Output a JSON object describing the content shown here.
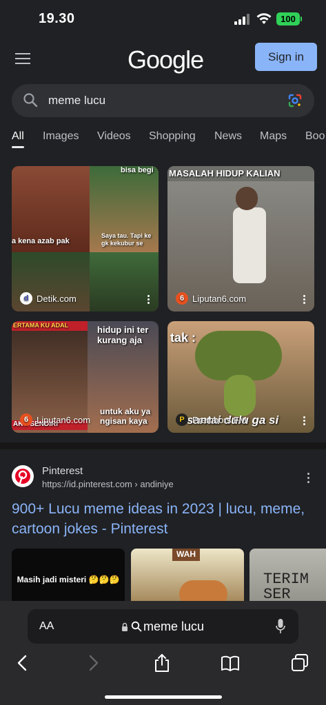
{
  "status": {
    "time": "19.30",
    "battery": "100"
  },
  "header": {
    "logo": "Google",
    "signin_label": "Sign in"
  },
  "search": {
    "query": "meme lucu"
  },
  "tabs": [
    "All",
    "Images",
    "Videos",
    "Shopping",
    "News",
    "Maps",
    "Boo"
  ],
  "images": [
    {
      "source": "Detik.com",
      "favicon": "d",
      "caption_top": "bisa begi",
      "caption_mid": "a kena azab pak",
      "caption_right": "Saya tau. Tapi ke gk kekubur se"
    },
    {
      "source": "Liputan6.com",
      "favicon": "6",
      "caption_top": "MASALAH HIDUP KALIAN"
    },
    {
      "source": "Liputan6.com",
      "favicon": "6",
      "caption_top": "ERTAMA KU ADAL",
      "caption_right_top": "hidup ini ter kurang aja",
      "caption_bottom_left": "AKU SENDIRI",
      "caption_bottom_right": "untuk aku ya ngisan kaya"
    },
    {
      "source": "Prambors FM",
      "favicon": "P",
      "caption_top": "tak :",
      "caption_bottom": "santai dulu ga si"
    }
  ],
  "result": {
    "site": "Pinterest",
    "url": "https://id.pinterest.com › andiniye",
    "title": "900+ Lucu meme ideas in 2023 | lucu, meme, cartoon jokes - Pinterest",
    "thumbs": [
      {
        "text": "Masih jadi misteri 🤔🤔🤔"
      },
      {
        "text": "WAH"
      },
      {
        "text": "TERIM SER"
      }
    ]
  },
  "browser": {
    "aa_label": "AA",
    "address": "meme lucu"
  },
  "colors": {
    "accent": "#8ab4f8",
    "battery": "#30d158",
    "background": "#202124"
  }
}
